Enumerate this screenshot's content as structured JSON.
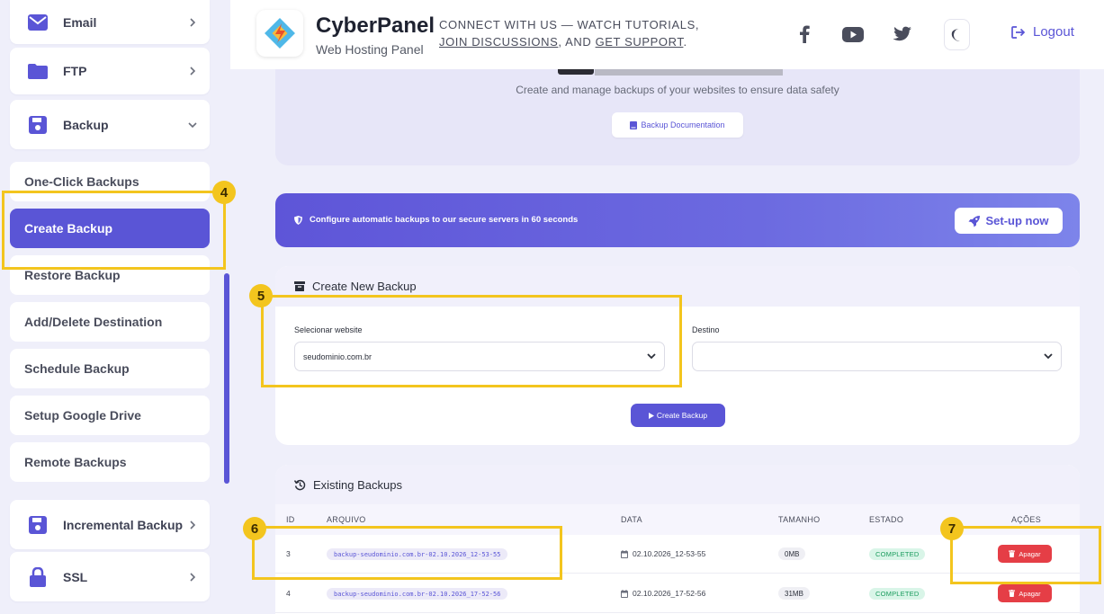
{
  "sidebar": {
    "email_label": "Email",
    "ftp_label": "FTP",
    "backup_label": "Backup",
    "sub_items": [
      {
        "label": "One-Click Backups"
      },
      {
        "label": "Create Backup"
      },
      {
        "label": "Restore Backup"
      },
      {
        "label": "Add/Delete Destination"
      },
      {
        "label": "Schedule Backup"
      },
      {
        "label": "Setup Google Drive"
      },
      {
        "label": "Remote Backups"
      }
    ],
    "incremental_label": "Incremental Backup",
    "ssl_label": "SSL"
  },
  "header": {
    "brand_title": "CyberPanel",
    "brand_subtitle": "Web Hosting Panel",
    "connect_prefix": "CONNECT WITH US — WATCH TUTORIALS, ",
    "connect_join": "JOIN DISCUSSIONS",
    "connect_mid": ", AND ",
    "connect_support": "GET SUPPORT",
    "connect_suffix": ".",
    "logout_label": "Logout"
  },
  "top_card": {
    "description": "Create and manage backups of your websites to ensure data safety",
    "doc_button": "Backup Documentation"
  },
  "banner": {
    "text": "Configure automatic backups to our secure servers in 60 seconds",
    "button": "Set-up now"
  },
  "create_backup": {
    "title": "Create New Backup",
    "website_label": "Selecionar website",
    "website_value": "seudominio.com.br",
    "destination_label": "Destino",
    "destination_value": "",
    "button": "Create Backup"
  },
  "existing_backups": {
    "title": "Existing Backups",
    "columns": [
      "ID",
      "ARQUIVO",
      "DATA",
      "TAMANHO",
      "ESTADO",
      "AÇÕES"
    ],
    "rows": [
      {
        "id": "3",
        "file": "backup-seudominio.com.br-02.10.2026_12-53-55",
        "date": "02.10.2026_12-53-55",
        "size": "0MB",
        "status": "COMPLETED",
        "action": "Apagar"
      },
      {
        "id": "4",
        "file": "backup-seudominio.com.br-02.10.2026_17-52-56",
        "date": "02.10.2026_17-52-56",
        "size": "31MB",
        "status": "COMPLETED",
        "action": "Apagar"
      }
    ]
  },
  "annotations": [
    "4",
    "5",
    "6",
    "7"
  ],
  "colors": {
    "accent": "#5a55d6",
    "highlight": "#f3c51e",
    "danger": "#e53e46",
    "success": "#1b9c5e"
  }
}
